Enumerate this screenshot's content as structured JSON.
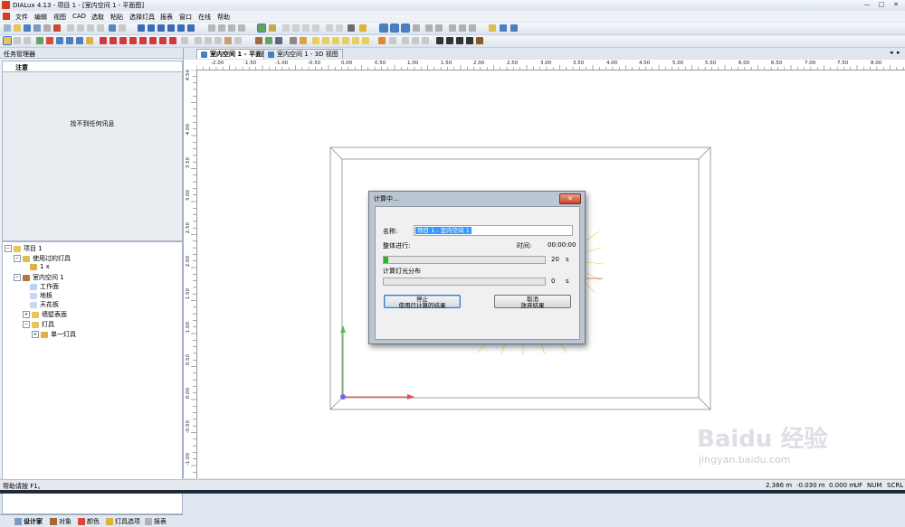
{
  "window": {
    "title": "DIALux 4.13 - 项目 1 - [室内空间 1 - 平面图]",
    "minimize": "—",
    "maximize": "□",
    "close": "✕"
  },
  "menu": [
    "文件",
    "编辑",
    "视图",
    "CAD",
    "选取",
    "粘贴",
    "选择灯具",
    "报表",
    "窗口",
    "在线",
    "帮助"
  ],
  "task_manager": {
    "header": "任务管理器",
    "note_tab": "注意",
    "note_message": "找不到任何讯息"
  },
  "tree": [
    {
      "label": "项目 1",
      "icon": "folder-icon"
    },
    {
      "label": "使用过的灯具",
      "icon": "luminaire-group-icon"
    },
    {
      "label": "1 x",
      "icon": "luminaire-icon"
    },
    {
      "label": "室内空间 1",
      "icon": "room-icon"
    },
    {
      "label": "工作面",
      "icon": "workplane-icon"
    },
    {
      "label": "地板",
      "icon": "floor-icon"
    },
    {
      "label": "天花板",
      "icon": "ceiling-icon"
    },
    {
      "label": "墙壁表面",
      "icon": "folder-icon"
    },
    {
      "label": "灯具",
      "icon": "folder-icon"
    },
    {
      "label": "单一灯具",
      "icon": "luminaire-icon"
    }
  ],
  "bottom_tabs": [
    "设计家",
    "对象",
    "颜色",
    "灯具选项",
    "报表"
  ],
  "doc_tabs": [
    "室内空间 1 - 平面图",
    "室内空间 1 - 3D 视图"
  ],
  "ruler": {
    "h_labels": [
      "-2.00",
      "-1.50",
      "-1.00",
      "-0.50",
      "0.00",
      "0.50",
      "1.00",
      "1.50",
      "2.00",
      "2.50",
      "3.00",
      "3.50",
      "4.00",
      "4.50",
      "5.00",
      "5.50",
      "6.00",
      "6.50",
      "7.00",
      "7.50",
      "8.00"
    ],
    "v_labels": [
      "4.50",
      "4.00",
      "3.50",
      "3.00",
      "2.50",
      "2.00",
      "1.50",
      "1.00",
      "0.50",
      "0.00",
      "-0.50",
      "-1.00"
    ]
  },
  "dialog": {
    "title": "计算中...",
    "close": "✕",
    "name_label": "名称:",
    "name_value": "项目 1 - 室内空间 1",
    "overall_label": "整体进行:",
    "time_label": "时间:",
    "time_value": "00:00:00",
    "overall_progress_percent": 3,
    "overall_seconds": "20",
    "overall_unit": "s",
    "subtask_label": "计算灯光分布",
    "subtask_progress_percent": 0,
    "subtask_seconds": "0",
    "subtask_unit": "s",
    "stop_button": [
      "停止",
      "使用已计算的结果"
    ],
    "cancel_button": [
      "取消",
      "放弃结果"
    ]
  },
  "status": {
    "help": "帮助请按 F1。",
    "x": "2.386 m",
    "y": "-0.030 m",
    "z": "0.000 m",
    "uf": "UF",
    "num": "NUM",
    "scrl": "SCRL"
  },
  "watermark": {
    "brand": "Baidu 经验",
    "url": "jingyan.baidu.com"
  },
  "colors": {
    "accent": "#3a78c4",
    "progress": "#2ab52a",
    "axis_x": "#e05050",
    "axis_y": "#50c050",
    "origin": "#6a6ae0"
  }
}
